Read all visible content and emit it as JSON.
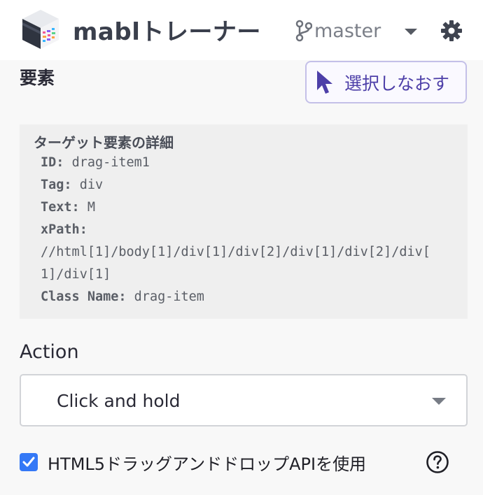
{
  "header": {
    "app_title": "mablトレーナー",
    "branch": "master",
    "logo_icon": "mabl-logo-icon",
    "branch_icon": "git-branch-icon",
    "settings_icon": "gear-icon"
  },
  "element_section": {
    "title": "要素",
    "reselect_label": "選択しなおす",
    "reselect_icon": "cursor-pointer-icon"
  },
  "target_details": {
    "heading": "ターゲット要素の詳細",
    "id_label": "ID:",
    "id_value": "drag-item1",
    "tag_label": "Tag:",
    "tag_value": "div",
    "text_label": "Text:",
    "text_value": "M",
    "xpath_label": "xPath:",
    "xpath_line1": "//html[1]/body[1]/div[1]/div[2]/div[1]/div[2]/div[",
    "xpath_line2": "1]/div[1]",
    "class_label": "Class Name:",
    "class_value": "drag-item"
  },
  "action": {
    "label": "Action",
    "selected": "Click and hold"
  },
  "html5_option": {
    "label": "HTML5ドラッグアンドドロップAPIを使用",
    "checked": true
  },
  "colors": {
    "accent": "#4d3fa8",
    "checkbox": "#3478f6"
  }
}
